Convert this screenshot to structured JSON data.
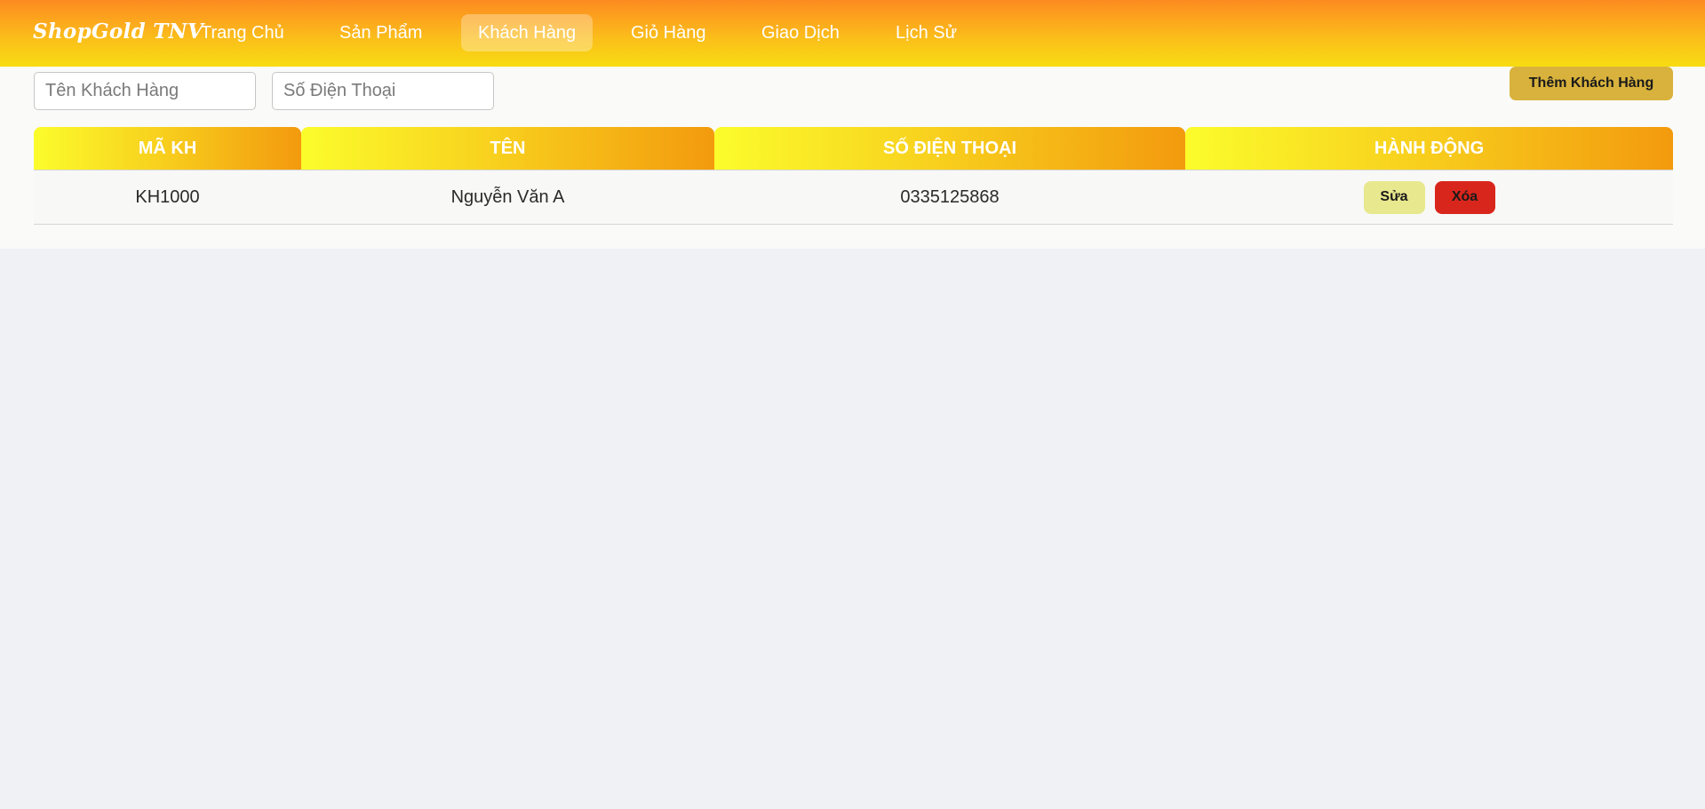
{
  "brand": {
    "name": "ShopGold TNV"
  },
  "nav": {
    "items": [
      {
        "label": "Trang Chủ",
        "active": false
      },
      {
        "label": "Sản Phẩm",
        "active": false
      },
      {
        "label": "Khách Hàng",
        "active": true
      },
      {
        "label": "Giỏ Hàng",
        "active": false
      },
      {
        "label": "Giao Dịch",
        "active": false
      },
      {
        "label": "Lịch Sử",
        "active": false
      }
    ]
  },
  "filters": {
    "name_placeholder": "Tên Khách Hàng",
    "name_value": "",
    "phone_placeholder": "Số Điện Thoại",
    "phone_value": ""
  },
  "toolbar": {
    "add_label": "Thêm Khách Hàng"
  },
  "table": {
    "headers": [
      "MÃ KH",
      "TÊN",
      "SỐ ĐIỆN THOẠI",
      "HÀNH ĐỘNG"
    ],
    "rows": [
      {
        "id": "KH1000",
        "name": "Nguyễn Văn A",
        "phone": "0335125868",
        "edit_label": "Sửa",
        "delete_label": "Xóa"
      }
    ]
  },
  "colors": {
    "nav_gradient_top": "#fd8b20",
    "nav_gradient_bottom": "#f7dc12",
    "header_gradient_start": "#fbfc2c",
    "header_gradient_end": "#f39a0e",
    "add_button": "#d8b23c",
    "edit_button": "#e8e88e",
    "delete_button": "#d9261c",
    "page_background": "#f0f1f4"
  }
}
